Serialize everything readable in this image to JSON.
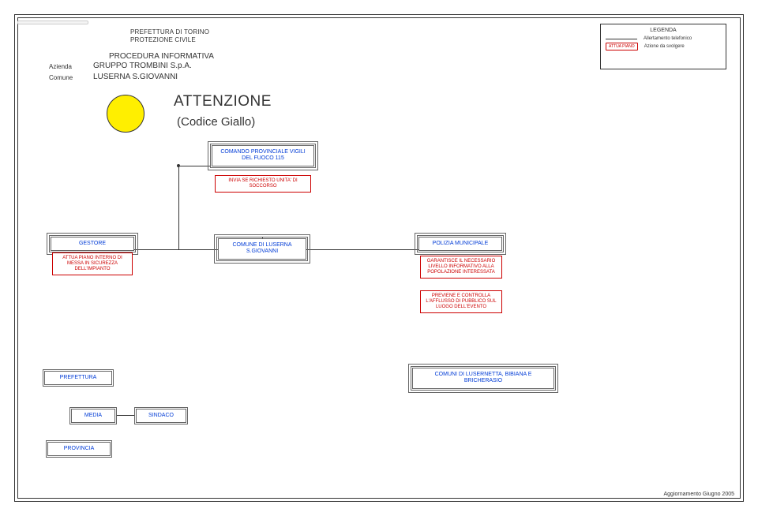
{
  "header": {
    "prefettura": "PREFETTURA DI TORINO",
    "protezione": "PROTEZIONE CIVILE",
    "procedura": "PROCEDURA INFORMATIVA",
    "azienda_label": "Azienda",
    "comune_label": "Comune",
    "azienda": "GRUPPO TROMBINI S.p.A.",
    "comune": "LUSERNA S.GIOVANNI",
    "title": "ATTENZIONE",
    "subtitle": "(Codice Giallo)"
  },
  "legend": {
    "title": "LEGENDA",
    "row1": "Allertamento telefonico",
    "pill": "ATTUA PIANO",
    "row2": "Azione da svolgere"
  },
  "nodes": {
    "comando": "COMANDO PROVINCIALE VIGILI DEL FUOCO 115",
    "soccorso": "INVIA SE RICHIESTO UNITA' DI SOCCORSO",
    "gestore": "GESTORE",
    "gestore_action": "ATTUA PIANO INTERNO DI MESSA IN SICUREZZA DELL'IMPIANTO",
    "comune": "COMUNE DI LUSERNA S.GIOVANNI",
    "polizia": "POLIZIA MUNICIPALE",
    "polizia_a": "GARANTISCE IL NECESSARIO LIVELLO INFORMATIVO ALLA POPOLAZIONE INTERESSATA",
    "polizia_b": "PREVIENE E CONTROLLA L'AFFLUSSO DI PUBBLICO SUL LUOGO DELL'EVENTO",
    "prefettura": "PREFETTURA",
    "media": "MEDIA",
    "sindaco": "SINDACO",
    "provincia": "PROVINCIA",
    "comuni": "COMUNI DI LUSERNETTA, BIBIANA E BRICHERASIO"
  },
  "footer": "Aggiornamento Giugno 2005"
}
